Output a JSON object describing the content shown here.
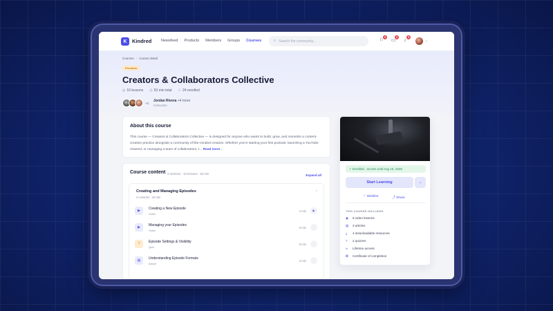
{
  "brand": {
    "name": "Kindred",
    "mark": "K"
  },
  "nav": {
    "items": [
      {
        "label": "Newsfeed",
        "active": false
      },
      {
        "label": "Products",
        "active": false
      },
      {
        "label": "Members",
        "active": false
      },
      {
        "label": "Groups",
        "active": false
      },
      {
        "label": "Courses",
        "active": true
      }
    ],
    "search_placeholder": "Search the community...",
    "notifications": [
      {
        "icon": "megaphone-icon",
        "count": "3"
      },
      {
        "icon": "chat-icon",
        "count": "2"
      },
      {
        "icon": "bell-icon",
        "count": "5"
      }
    ]
  },
  "breadcrumb": {
    "root": "Courses",
    "current": "Course detail"
  },
  "course": {
    "badge": "Premium",
    "title": "Creators & Collaborators Collective",
    "meta": {
      "lessons": "10 lessons",
      "duration": "53 min total",
      "enrolled": "24 enrolled"
    },
    "avatars_more": "+2",
    "instructor": {
      "name": "Jordan Rivera",
      "more": "+4 more",
      "role": "Instructors"
    }
  },
  "about": {
    "heading": "About this course",
    "text": "This course — Creators & Collaborators Collective — is designed for anyone who wants to build, grow, and monetize a content-creation practice alongside a community of like-minded creators. Whether you're starting your first podcast, launching a YouTube channel, or managing a team of collaborators, t...",
    "read_more": "Read more ↓"
  },
  "content": {
    "heading": "Course content",
    "summary": "4 sections · 10 lessons · 53 min",
    "expand_all": "Expand all",
    "section": {
      "title": "Creating and Managing Episodes",
      "sub": "4 Lessons · 18 min",
      "lessons": [
        {
          "title": "Creating a New Episode",
          "kind": "Video",
          "type": "video",
          "duration": "4 min",
          "icon": "play-icon"
        },
        {
          "title": "Managing your Episodes",
          "kind": "Video",
          "type": "video",
          "duration": "5 min",
          "icon": "play-icon"
        },
        {
          "title": "Episode Settings & Visibility",
          "kind": "Quiz",
          "type": "quiz",
          "duration": "5 min",
          "icon": "quiz-icon"
        },
        {
          "title": "Understanding Episode Formats",
          "kind": "Article",
          "type": "article",
          "duration": "3 min",
          "icon": "article-icon"
        }
      ]
    }
  },
  "sidebar": {
    "enrolled_text": "Enrolled · access until Aug 15, 2025",
    "start_label": "Start Learning",
    "wishlist_label": "Wishlist",
    "share_label": "Share",
    "includes_heading": "THIS COURSE INCLUDES",
    "includes": [
      {
        "icon": "video-icon",
        "glyph": "◉",
        "label": "6 video lessons"
      },
      {
        "icon": "article-icon",
        "glyph": "▤",
        "label": "3 articles"
      },
      {
        "icon": "download-icon",
        "glyph": "⤓",
        "label": "4 downloadable resources"
      },
      {
        "icon": "quiz-icon",
        "glyph": "?",
        "label": "2 quizzes"
      },
      {
        "icon": "infinity-icon",
        "glyph": "∞",
        "label": "Lifetime access"
      },
      {
        "icon": "certificate-icon",
        "glyph": "✪",
        "label": "Certificate of completion"
      }
    ]
  },
  "colors": {
    "accent": "#4b4ee6",
    "success": "#1f8a4c",
    "premium": "#c87a12"
  }
}
